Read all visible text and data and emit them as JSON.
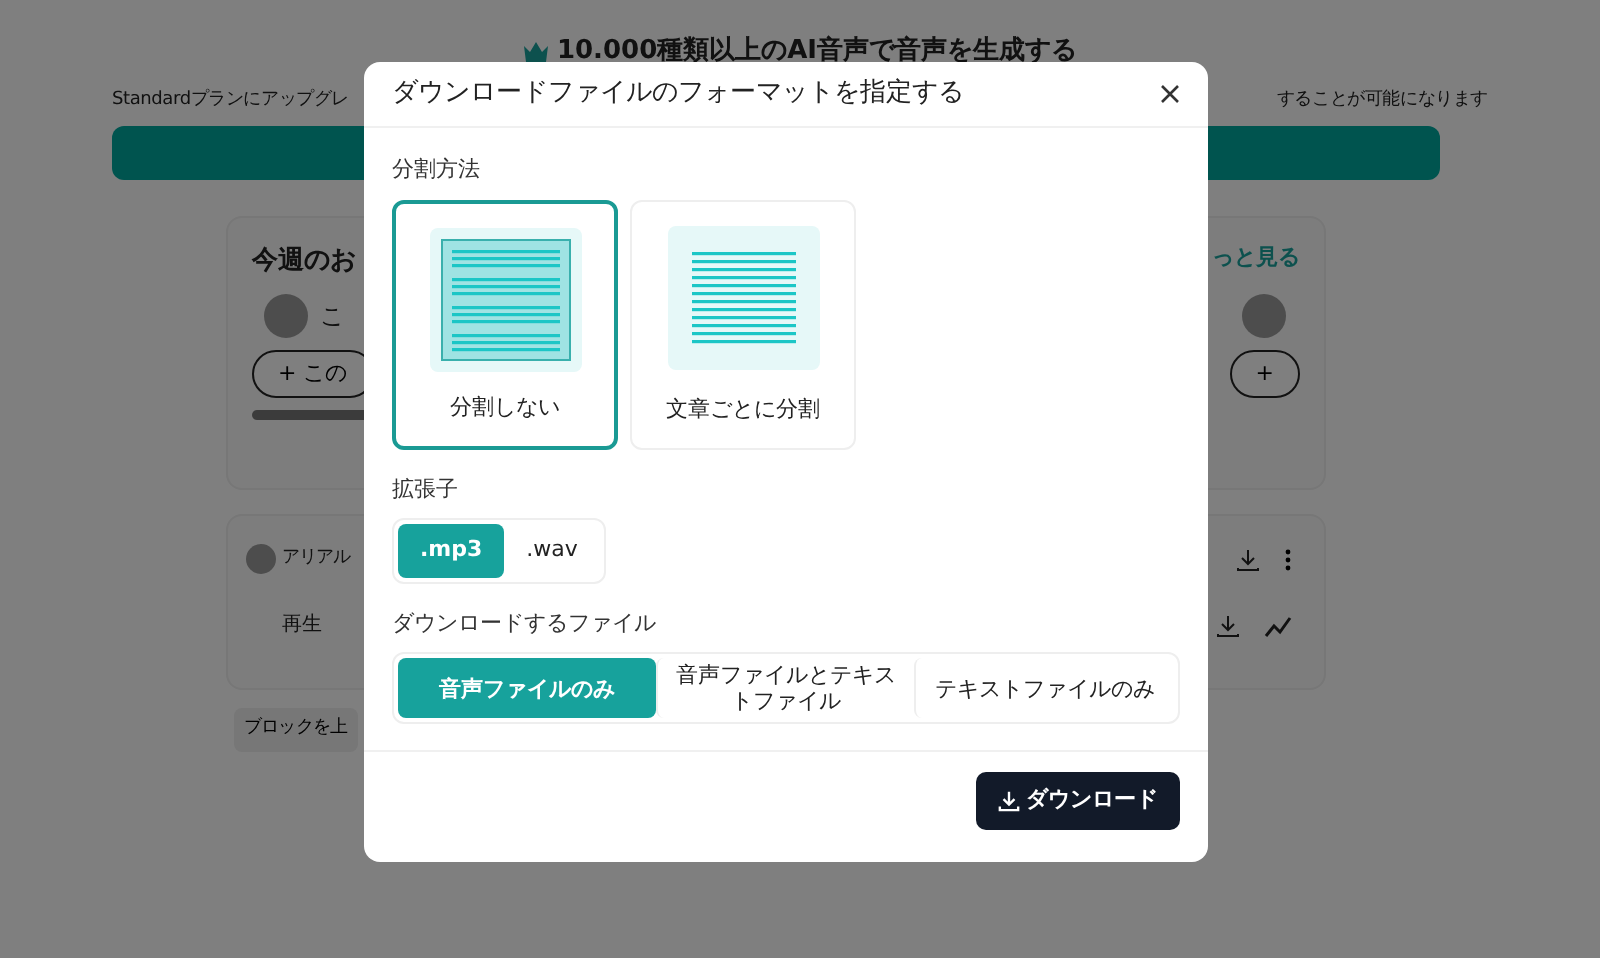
{
  "background": {
    "heading": "10.000種類以上のAI音声で音声を生成する",
    "notice_left": "Standardプランにアップグレ",
    "notice_right": "することが可能になります",
    "recommend": {
      "title": "今週のお",
      "more_link": "っと見る",
      "voice_name": "こ",
      "add_button": "+ この",
      "right_add_button": "+"
    },
    "block": {
      "speaker": "アリアル",
      "play_label": "再生"
    },
    "block_button": "ブロックを上"
  },
  "dialog": {
    "title": "ダウンロードファイルのフォーマットを指定する",
    "split_label": "分割方法",
    "split_options": [
      {
        "label": "分割しない",
        "kind": "single",
        "selected": true
      },
      {
        "label": "文章ごとに分割",
        "kind": "sentences",
        "selected": false
      }
    ],
    "extension_label": "拡張子",
    "extensions": [
      {
        "label": ".mp3",
        "selected": true
      },
      {
        "label": ".wav",
        "selected": false
      }
    ],
    "file_label": "ダウンロードするファイル",
    "file_options": [
      {
        "label": "音声ファイルのみ",
        "selected": true
      },
      {
        "label": "音声ファイルとテキストファイル",
        "selected": false
      },
      {
        "label": "テキストファイルのみ",
        "selected": false
      }
    ],
    "download_button": "ダウンロード"
  }
}
